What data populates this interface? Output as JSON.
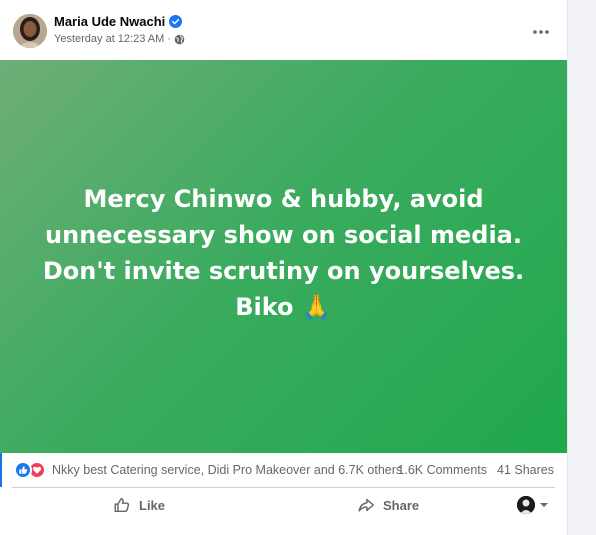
{
  "author": {
    "name": "Maria Ude Nwachi",
    "timestamp": "Yesterday at 12:23 AM",
    "separator": "·",
    "verified": true,
    "privacy": "globe-icon"
  },
  "post": {
    "text": "Mercy Chinwo & hubby, avoid unnecessary show on social media. Don't invite scrutiny on yourselves. Biko 🙏",
    "background_start": "#6fae78",
    "background_end": "#1fa84c"
  },
  "stats": {
    "reactions": [
      "like-icon",
      "love-icon"
    ],
    "reaction_names": "Nkky best Catering service, Didi Pro Makeover and 6.7K others",
    "comments": "1.6K Comments",
    "shares": "41 Shares"
  },
  "actions": {
    "like_label": "Like",
    "share_label": "Share"
  },
  "colors": {
    "brand": "#1877f2",
    "love": "#f33e58",
    "secondary_text": "#65676b"
  }
}
